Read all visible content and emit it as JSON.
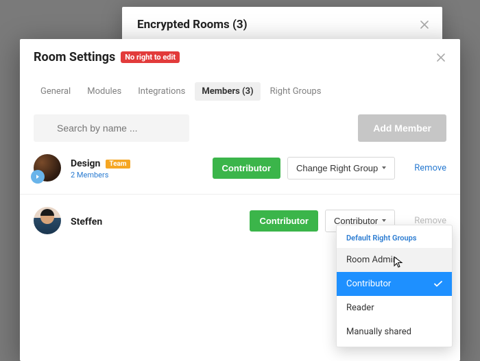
{
  "backModal": {
    "title": "Encrypted Rooms (3)"
  },
  "frontModal": {
    "title": "Room Settings",
    "badge": "No right to edit",
    "tabs": [
      "General",
      "Modules",
      "Integrations",
      "Members (3)",
      "Right Groups"
    ],
    "activeTab": 3,
    "search": {
      "placeholder": "Search by name ..."
    },
    "addMember": "Add Member",
    "members": [
      {
        "name": "Design",
        "tag": "Team",
        "sub": "2 Members",
        "role": "Contributor",
        "changeLabel": "Change Right Group",
        "removeLabel": "Remove",
        "removeEnabled": true
      },
      {
        "name": "Steffen",
        "role": "Contributor",
        "dropdownLabel": "Contributor",
        "removeLabel": "Remove",
        "removeEnabled": false
      }
    ],
    "dropdown": {
      "header": "Default Right Groups",
      "items": [
        "Room Admin",
        "Contributor",
        "Reader",
        "Manually shared"
      ],
      "selected": 1,
      "hover": 0
    }
  }
}
